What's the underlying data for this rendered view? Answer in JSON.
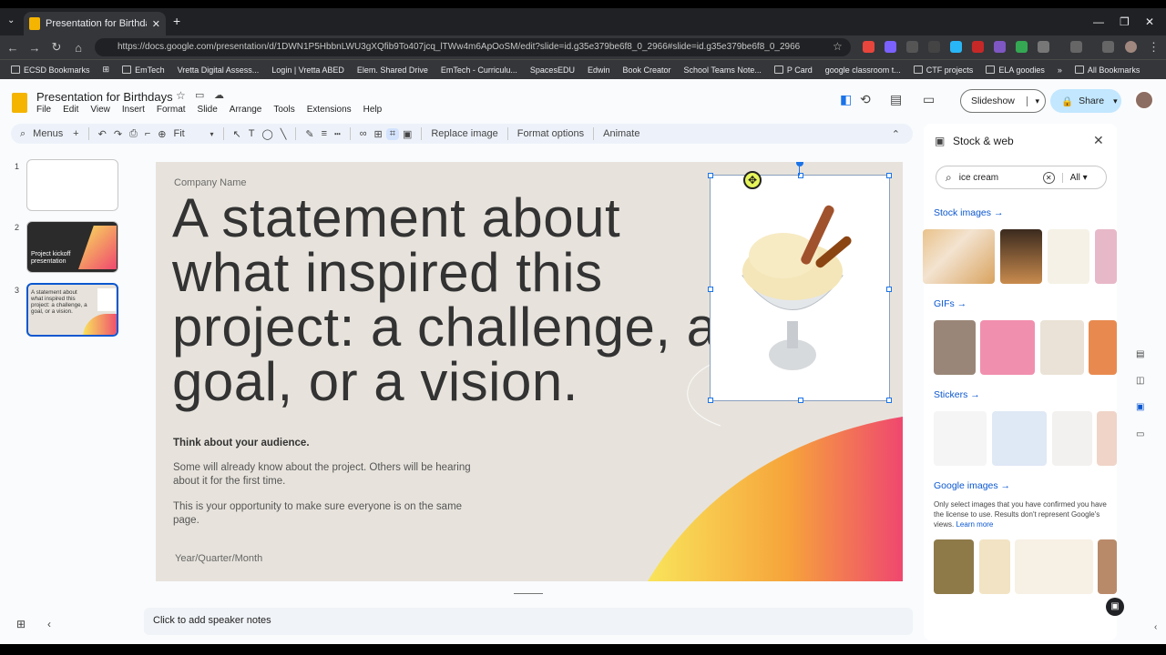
{
  "browser": {
    "tab_title": "Presentation for Birthdays - Goo",
    "url": "https://docs.google.com/presentation/d/1DWN1P5HbbnLWU3gXQfib9To407jcq_lTWw4m6ApOoSM/edit?slide=id.g35e379be6f8_0_2966#slide=id.g35e379be6f8_0_2966",
    "bookmarks": [
      "ECSD Bookmarks",
      "EmTech",
      "Vretta Digital Assess...",
      "Login | Vretta ABED",
      "Elem. Shared Drive",
      "EmTech - Curriculu...",
      "SpacesEDU",
      "Edwin",
      "Book Creator",
      "School Teams Note...",
      "P Card",
      "google classroom t...",
      "CTF projects",
      "ELA goodies",
      "All Bookmarks"
    ]
  },
  "app": {
    "title": "Presentation for Birthdays",
    "menus": [
      "File",
      "Edit",
      "View",
      "Insert",
      "Format",
      "Slide",
      "Arrange",
      "Tools",
      "Extensions",
      "Help"
    ],
    "slideshow_label": "Slideshow",
    "share_label": "Share"
  },
  "toolbar": {
    "menus_label": "Menus",
    "zoom_label": "Fit",
    "replace_image": "Replace image",
    "format_options": "Format options",
    "animate": "Animate"
  },
  "filmstrip": [
    {
      "num": "1",
      "text": ""
    },
    {
      "num": "2",
      "text": "Project kickoff presentation"
    },
    {
      "num": "3",
      "text": "A statement about what inspired this project: a challenge, a goal, or a vision."
    }
  ],
  "slide": {
    "company": "Company Name",
    "statement": "A statement about what inspired this project: a challenge, a goal, or a vision.",
    "audience_heading": "Think about your audience.",
    "audience_p1": "Some will already know about the project. Others will be hearing about it for the first time.",
    "audience_p2": "This is your opportunity to make sure everyone is on the same page.",
    "date": "Year/Quarter/Month"
  },
  "notes": {
    "placeholder": "Click to add speaker notes"
  },
  "panel": {
    "title": "Stock & web",
    "search_value": "ice cream",
    "filter": "All",
    "sections": {
      "stock": "Stock images",
      "gifs": "GIFs",
      "stickers": "Stickers",
      "google": "Google images"
    },
    "google_note": "Only select images that you have confirmed you have the license to use. Results don't represent Google's views.",
    "learn_more": "Learn more"
  },
  "colors": {
    "accent": "#0b57d0",
    "share": "#c2e7ff",
    "gradient_start": "#f9e45b",
    "gradient_end": "#ef476f"
  }
}
